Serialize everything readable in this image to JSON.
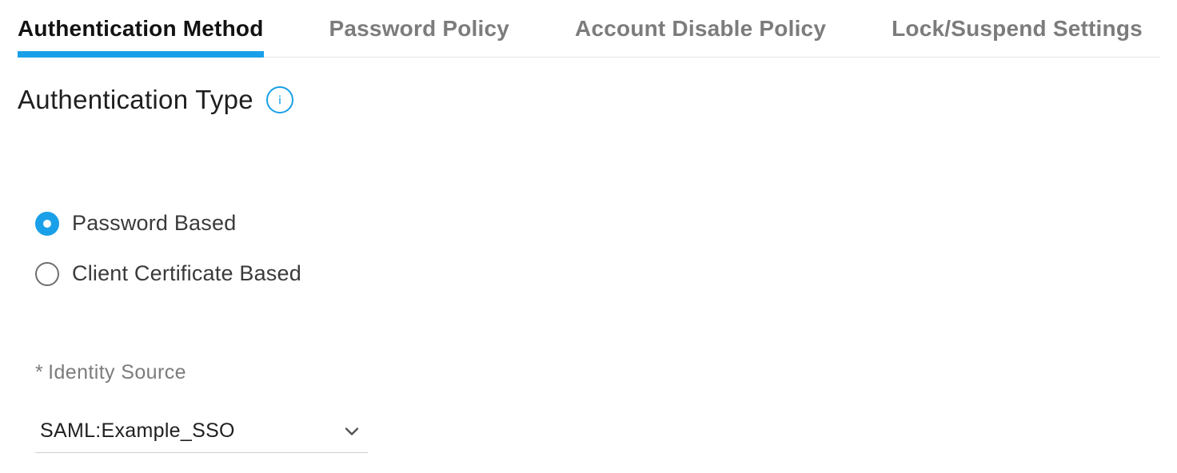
{
  "tabs": [
    {
      "label": "Authentication Method",
      "active": true
    },
    {
      "label": "Password Policy",
      "active": false
    },
    {
      "label": "Account Disable Policy",
      "active": false
    },
    {
      "label": "Lock/Suspend Settings",
      "active": false
    }
  ],
  "section": {
    "title": "Authentication Type",
    "info_tooltip": "info"
  },
  "auth_type": {
    "options": [
      {
        "label": "Password Based",
        "checked": true
      },
      {
        "label": "Client Certificate Based",
        "checked": false
      }
    ]
  },
  "identity_source": {
    "required_mark": "*",
    "label": "Identity Source",
    "selected": "SAML:Example_SSO"
  }
}
